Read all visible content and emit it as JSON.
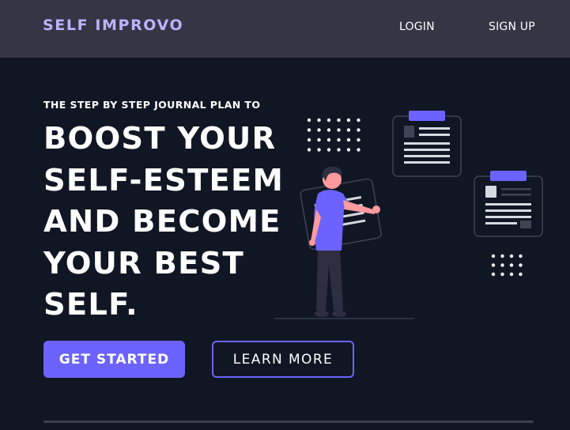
{
  "nav": {
    "brand": "SELF IMPROVO",
    "login": "LOGIN",
    "signup": "SIGN UP"
  },
  "hero": {
    "eyebrow": "THE STEP BY STEP JOURNAL PLAN TO",
    "headline_lines": [
      "BOOST YOUR",
      "SELF-ESTEEM",
      "AND BECOME",
      "YOUR BEST",
      "SELF."
    ],
    "primary_cta": "GET STARTED",
    "secondary_cta": "LEARN MORE"
  },
  "colors": {
    "accent": "#6c63ff",
    "background": "#111624",
    "navbar": "#363545",
    "brand": "#bcb3ff"
  },
  "icons": [
    "dot-grid-icon",
    "clipboard-icon",
    "person-illustration"
  ]
}
